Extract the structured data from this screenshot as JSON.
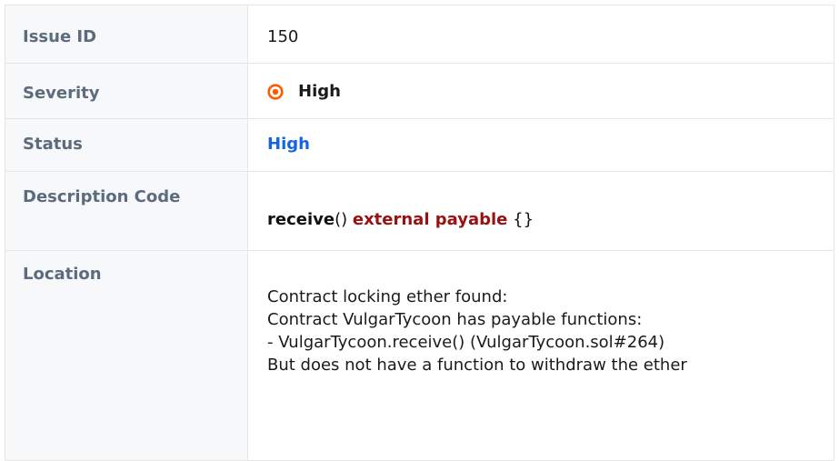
{
  "issue": {
    "id_label": "Issue ID",
    "id_value": "150",
    "severity_label": "Severity",
    "severity_value": "High",
    "severity_icon": "target-icon",
    "severity_color": "#ff5a00",
    "status_label": "Status",
    "status_value": "High",
    "status_color": "#1565e0",
    "description_label": "Description Code",
    "code": {
      "fn_name": "receive",
      "parens": "() ",
      "modifiers": "external payable",
      "body": " {}"
    },
    "location_label": "Location",
    "location_lines": [
      "Contract locking ether found:",
      "Contract VulgarTycoon has payable functions:",
      "- VulgarTycoon.receive() (VulgarTycoon.sol#264)",
      "But does not have a function to withdraw the ether"
    ]
  }
}
